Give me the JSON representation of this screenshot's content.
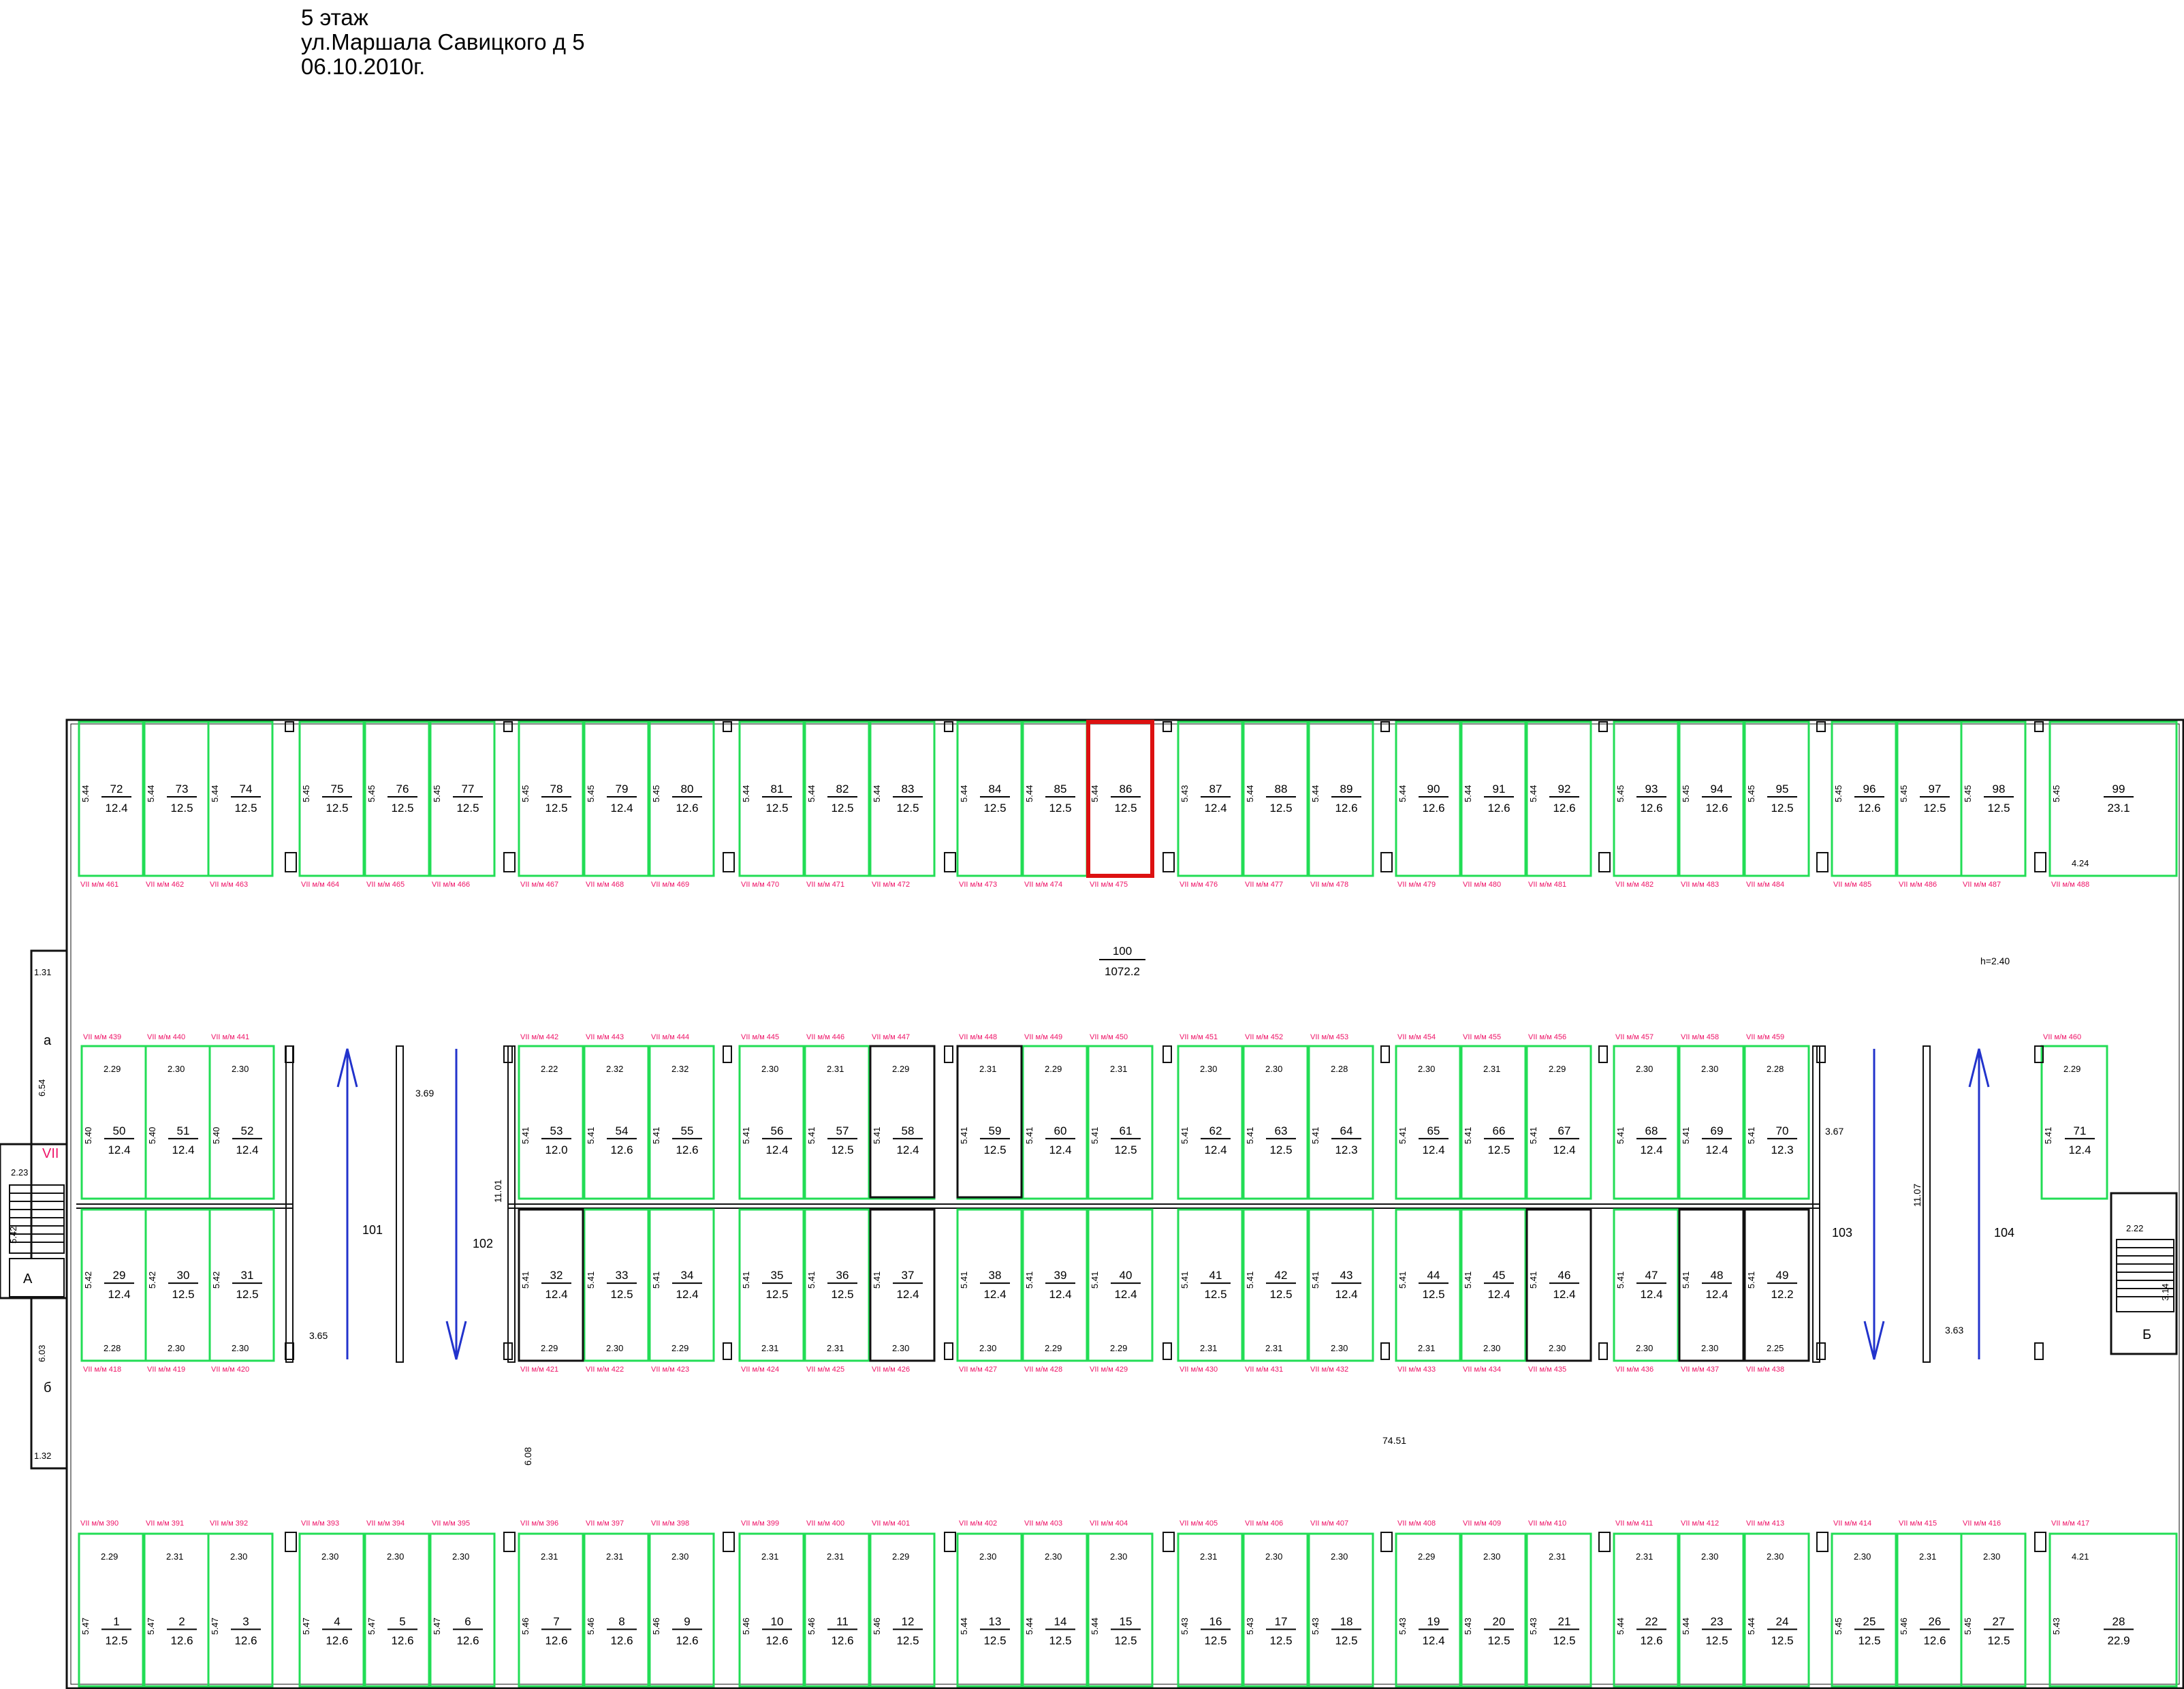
{
  "header": {
    "floor": "5 этаж",
    "address": "ул.Маршала Савицкого д 5",
    "date": "06.10.2010г."
  },
  "colors": {
    "bay": "#22dd55",
    "tag": "#ee1166",
    "highlight": "#dd1111",
    "arrow": "#2233cc"
  },
  "main_hall": {
    "number": "100",
    "area": "1072.2",
    "height": "h=2.40",
    "length": "74.51"
  },
  "passages": [
    {
      "number": "101",
      "width": "3.69",
      "length": "3.65"
    },
    {
      "number": "102",
      "width": "11.01",
      "length": "6.08"
    },
    {
      "number": "103",
      "width": "3.67",
      "length": "11.07"
    },
    {
      "number": "104",
      "width": "3.63",
      "length": ""
    }
  ],
  "stairs": {
    "left": {
      "label": "VII",
      "letter_top": "а",
      "letter_bottom": "б",
      "block": "А",
      "dims": [
        "1.31",
        "6.54",
        "2.23",
        "5.42",
        "6.03",
        "1.32"
      ]
    },
    "right": {
      "block": "Б",
      "dims": [
        "2.22",
        "3.14"
      ]
    }
  },
  "rows": {
    "top": [
      {
        "n": "72",
        "a": "12.4",
        "d": "5.44",
        "tag": "VII м/м 461"
      },
      {
        "n": "73",
        "a": "12.5",
        "d": "5.44",
        "tag": "VII м/м 462"
      },
      {
        "n": "74",
        "a": "12.5",
        "d": "5.44",
        "tag": "VII м/м 463"
      },
      {
        "n": "75",
        "a": "12.5",
        "d": "5.45",
        "tag": "VII м/м 464"
      },
      {
        "n": "76",
        "a": "12.5",
        "d": "5.45",
        "tag": "VII м/м 465"
      },
      {
        "n": "77",
        "a": "12.5",
        "d": "5.45",
        "tag": "VII м/м 466"
      },
      {
        "n": "78",
        "a": "12.5",
        "d": "5.45",
        "tag": "VII м/м 467"
      },
      {
        "n": "79",
        "a": "12.4",
        "d": "5.45",
        "tag": "VII м/м 468"
      },
      {
        "n": "80",
        "a": "12.6",
        "d": "5.45",
        "tag": "VII м/м 469"
      },
      {
        "n": "81",
        "a": "12.5",
        "d": "5.44",
        "tag": "VII м/м 470"
      },
      {
        "n": "82",
        "a": "12.5",
        "d": "5.44",
        "tag": "VII м/м 471"
      },
      {
        "n": "83",
        "a": "12.5",
        "d": "5.44",
        "tag": "VII м/м 472"
      },
      {
        "n": "84",
        "a": "12.5",
        "d": "5.44",
        "tag": "VII м/м 473"
      },
      {
        "n": "85",
        "a": "12.5",
        "d": "5.44",
        "tag": "VII м/м 474"
      },
      {
        "n": "86",
        "a": "12.5",
        "d": "5.44",
        "tag": "VII м/м 475",
        "hl": true
      },
      {
        "n": "87",
        "a": "12.4",
        "d": "5.43",
        "tag": "VII м/м 476"
      },
      {
        "n": "88",
        "a": "12.5",
        "d": "5.44",
        "tag": "VII м/м 477"
      },
      {
        "n": "89",
        "a": "12.6",
        "d": "5.44",
        "tag": "VII м/м 478"
      },
      {
        "n": "90",
        "a": "12.6",
        "d": "5.44",
        "tag": "VII м/м 479"
      },
      {
        "n": "91",
        "a": "12.6",
        "d": "5.44",
        "tag": "VII м/м 480"
      },
      {
        "n": "92",
        "a": "12.6",
        "d": "5.44",
        "tag": "VII м/м 481"
      },
      {
        "n": "93",
        "a": "12.6",
        "d": "5.45",
        "tag": "VII м/м 482"
      },
      {
        "n": "94",
        "a": "12.6",
        "d": "5.45",
        "tag": "VII м/м 483"
      },
      {
        "n": "95",
        "a": "12.5",
        "d": "5.45",
        "tag": "VII м/м 484"
      },
      {
        "n": "96",
        "a": "12.6",
        "d": "5.45",
        "tag": "VII м/м 485"
      },
      {
        "n": "97",
        "a": "12.5",
        "d": "5.45",
        "tag": "VII м/м 486"
      },
      {
        "n": "98",
        "a": "12.5",
        "d": "5.45",
        "tag": "VII м/м 487"
      },
      {
        "n": "99",
        "a": "23.1",
        "d": "5.45",
        "w": "4.24",
        "tag": "VII м/м 488"
      }
    ],
    "mid_upper": [
      {
        "n": "50",
        "a": "12.4",
        "d": "5.40",
        "w": "2.29",
        "tag": "VII м/м 439"
      },
      {
        "n": "51",
        "a": "12.4",
        "d": "5.40",
        "w": "2.30",
        "tag": "VII м/м 440"
      },
      {
        "n": "52",
        "a": "12.4",
        "d": "5.40",
        "w": "2.30",
        "tag": "VII м/м 441"
      },
      {
        "n": "53",
        "a": "12.0",
        "d": "5.41",
        "w": "2.22",
        "tag": "VII м/м 442"
      },
      {
        "n": "54",
        "a": "12.6",
        "d": "5.41",
        "w": "2.32",
        "tag": "VII м/м 443"
      },
      {
        "n": "55",
        "a": "12.6",
        "d": "5.41",
        "w": "2.32",
        "tag": "VII м/м 444"
      },
      {
        "n": "56",
        "a": "12.4",
        "d": "5.41",
        "w": "2.30",
        "tag": "VII м/м 445"
      },
      {
        "n": "57",
        "a": "12.5",
        "d": "5.41",
        "w": "2.31",
        "tag": "VII м/м 446"
      },
      {
        "n": "58",
        "a": "12.4",
        "d": "5.41",
        "w": "2.29",
        "tag": "VII м/м 447"
      },
      {
        "n": "59",
        "a": "12.5",
        "d": "5.41",
        "w": "2.31",
        "tag": "VII м/м 448"
      },
      {
        "n": "60",
        "a": "12.4",
        "d": "5.41",
        "w": "2.29",
        "tag": "VII м/м 449"
      },
      {
        "n": "61",
        "a": "12.5",
        "d": "5.41",
        "w": "2.31",
        "tag": "VII м/м 450"
      },
      {
        "n": "62",
        "a": "12.4",
        "d": "5.41",
        "w": "2.30",
        "tag": "VII м/м 451"
      },
      {
        "n": "63",
        "a": "12.5",
        "d": "5.41",
        "w": "2.30",
        "tag": "VII м/м 452"
      },
      {
        "n": "64",
        "a": "12.3",
        "d": "5.41",
        "w": "2.28",
        "tag": "VII м/м 453"
      },
      {
        "n": "65",
        "a": "12.4",
        "d": "5.41",
        "w": "2.30",
        "tag": "VII м/м 454"
      },
      {
        "n": "66",
        "a": "12.5",
        "d": "5.41",
        "w": "2.31",
        "tag": "VII м/м 455"
      },
      {
        "n": "67",
        "a": "12.4",
        "d": "5.41",
        "w": "2.29",
        "tag": "VII м/м 456"
      },
      {
        "n": "68",
        "a": "12.4",
        "d": "5.41",
        "w": "2.30",
        "tag": "VII м/м 457"
      },
      {
        "n": "69",
        "a": "12.4",
        "d": "5.41",
        "w": "2.30",
        "tag": "VII м/м 458"
      },
      {
        "n": "70",
        "a": "12.3",
        "d": "5.41",
        "w": "2.28",
        "tag": "VII м/м 459"
      },
      {
        "n": "71",
        "a": "12.4",
        "d": "5.41",
        "w": "2.29",
        "tag": "VII м/м 460"
      }
    ],
    "mid_lower": [
      {
        "n": "29",
        "a": "12.4",
        "d": "5.42",
        "w": "2.28",
        "tag": "VII м/м 418"
      },
      {
        "n": "30",
        "a": "12.5",
        "d": "5.42",
        "w": "2.30",
        "tag": "VII м/м 419"
      },
      {
        "n": "31",
        "a": "12.5",
        "d": "5.42",
        "w": "2.30",
        "tag": "VII м/м 420"
      },
      {
        "n": "32",
        "a": "12.4",
        "d": "5.41",
        "w": "2.29",
        "tag": "VII м/м 421"
      },
      {
        "n": "33",
        "a": "12.5",
        "d": "5.41",
        "w": "2.30",
        "tag": "VII м/м 422"
      },
      {
        "n": "34",
        "a": "12.4",
        "d": "5.41",
        "w": "2.29",
        "tag": "VII м/м 423"
      },
      {
        "n": "35",
        "a": "12.5",
        "d": "5.41",
        "w": "2.31",
        "tag": "VII м/м 424"
      },
      {
        "n": "36",
        "a": "12.5",
        "d": "5.41",
        "w": "2.31",
        "tag": "VII м/м 425"
      },
      {
        "n": "37",
        "a": "12.4",
        "d": "5.41",
        "w": "2.30",
        "tag": "VII м/м 426"
      },
      {
        "n": "38",
        "a": "12.4",
        "d": "5.41",
        "w": "2.30",
        "tag": "VII м/м 427"
      },
      {
        "n": "39",
        "a": "12.4",
        "d": "5.41",
        "w": "2.29",
        "tag": "VII м/м 428"
      },
      {
        "n": "40",
        "a": "12.4",
        "d": "5.41",
        "w": "2.29",
        "tag": "VII м/м 429"
      },
      {
        "n": "41",
        "a": "12.5",
        "d": "5.41",
        "w": "2.31",
        "tag": "VII м/м 430"
      },
      {
        "n": "42",
        "a": "12.5",
        "d": "5.41",
        "w": "2.31",
        "tag": "VII м/м 431"
      },
      {
        "n": "43",
        "a": "12.4",
        "d": "5.41",
        "w": "2.30",
        "tag": "VII м/м 432"
      },
      {
        "n": "44",
        "a": "12.5",
        "d": "5.41",
        "w": "2.31",
        "tag": "VII м/м 433"
      },
      {
        "n": "45",
        "a": "12.4",
        "d": "5.41",
        "w": "2.30",
        "tag": "VII м/м 434"
      },
      {
        "n": "46",
        "a": "12.4",
        "d": "5.41",
        "w": "2.30",
        "tag": "VII м/м 435"
      },
      {
        "n": "47",
        "a": "12.4",
        "d": "5.41",
        "w": "2.30",
        "tag": "VII м/м 436"
      },
      {
        "n": "48",
        "a": "12.4",
        "d": "5.41",
        "w": "2.30",
        "tag": "VII м/м 437"
      },
      {
        "n": "49",
        "a": "12.2",
        "d": "5.41",
        "w": "2.25",
        "tag": "VII м/м 438"
      }
    ],
    "bottom": [
      {
        "n": "1",
        "a": "12.5",
        "d": "5.47",
        "w": "2.29",
        "tag": "VII м/м 390"
      },
      {
        "n": "2",
        "a": "12.6",
        "d": "5.47",
        "w": "2.31",
        "tag": "VII м/м 391"
      },
      {
        "n": "3",
        "a": "12.6",
        "d": "5.47",
        "w": "2.30",
        "tag": "VII м/м 392"
      },
      {
        "n": "4",
        "a": "12.6",
        "d": "5.47",
        "w": "2.30",
        "tag": "VII м/м 393"
      },
      {
        "n": "5",
        "a": "12.6",
        "d": "5.47",
        "w": "2.30",
        "tag": "VII м/м 394"
      },
      {
        "n": "6",
        "a": "12.6",
        "d": "5.47",
        "w": "2.30",
        "tag": "VII м/м 395"
      },
      {
        "n": "7",
        "a": "12.6",
        "d": "5.46",
        "w": "2.31",
        "tag": "VII м/м 396"
      },
      {
        "n": "8",
        "a": "12.6",
        "d": "5.46",
        "w": "2.31",
        "tag": "VII м/м 397"
      },
      {
        "n": "9",
        "a": "12.6",
        "d": "5.46",
        "w": "2.30",
        "tag": "VII м/м 398"
      },
      {
        "n": "10",
        "a": "12.6",
        "d": "5.46",
        "w": "2.31",
        "tag": "VII м/м 399"
      },
      {
        "n": "11",
        "a": "12.6",
        "d": "5.46",
        "w": "2.31",
        "tag": "VII м/м 400"
      },
      {
        "n": "12",
        "a": "12.5",
        "d": "5.46",
        "w": "2.29",
        "tag": "VII м/м 401"
      },
      {
        "n": "13",
        "a": "12.5",
        "d": "5.44",
        "w": "2.30",
        "tag": "VII м/м 402"
      },
      {
        "n": "14",
        "a": "12.5",
        "d": "5.44",
        "w": "2.30",
        "tag": "VII м/м 403"
      },
      {
        "n": "15",
        "a": "12.5",
        "d": "5.44",
        "w": "2.30",
        "tag": "VII м/м 404"
      },
      {
        "n": "16",
        "a": "12.5",
        "d": "5.43",
        "w": "2.31",
        "tag": "VII м/м 405"
      },
      {
        "n": "17",
        "a": "12.5",
        "d": "5.43",
        "w": "2.30",
        "tag": "VII м/м 406"
      },
      {
        "n": "18",
        "a": "12.5",
        "d": "5.43",
        "w": "2.30",
        "tag": "VII м/м 407"
      },
      {
        "n": "19",
        "a": "12.4",
        "d": "5.43",
        "w": "2.29",
        "tag": "VII м/м 408"
      },
      {
        "n": "20",
        "a": "12.5",
        "d": "5.43",
        "w": "2.30",
        "tag": "VII м/м 409"
      },
      {
        "n": "21",
        "a": "12.5",
        "d": "5.43",
        "w": "2.31",
        "tag": "VII м/м 410"
      },
      {
        "n": "22",
        "a": "12.6",
        "d": "5.44",
        "w": "2.31",
        "tag": "VII м/м 411"
      },
      {
        "n": "23",
        "a": "12.5",
        "d": "5.44",
        "w": "2.30",
        "tag": "VII м/м 412"
      },
      {
        "n": "24",
        "a": "12.5",
        "d": "5.44",
        "w": "2.30",
        "tag": "VII м/м 413"
      },
      {
        "n": "25",
        "a": "12.5",
        "d": "5.45",
        "w": "2.30",
        "tag": "VII м/м 414"
      },
      {
        "n": "26",
        "a": "12.6",
        "d": "5.46",
        "w": "2.31",
        "tag": "VII м/м 415"
      },
      {
        "n": "27",
        "a": "12.5",
        "d": "5.45",
        "w": "2.30",
        "tag": "VII м/м 416"
      },
      {
        "n": "28",
        "a": "22.9",
        "d": "5.43",
        "w": "4.21",
        "tag": "VII м/м 417"
      }
    ]
  }
}
